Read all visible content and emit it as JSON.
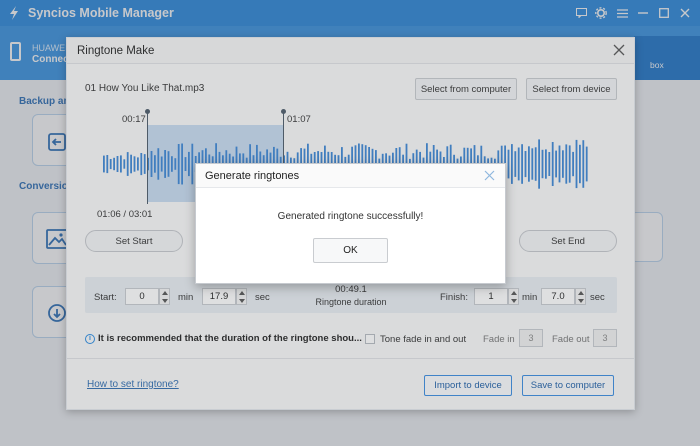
{
  "app": {
    "title": "Syncios Mobile Manager",
    "device_brand": "HUAWEI",
    "device_state": "Connect",
    "toolbox_label": "box",
    "backup_section": "Backup an",
    "conversion_section": "Conversion"
  },
  "ringtone_dialog": {
    "title": "Ringtone Make",
    "file_name": "01 How You Like That.mp3",
    "select_from_computer": "Select from computer",
    "select_from_device": "Select from device",
    "marker_start_time": "00:17",
    "marker_end_time": "01:07",
    "playback_position": "01:06 / 03:01",
    "set_start_label": "Set Start",
    "set_end_label": "Set End",
    "start_label": "Start:",
    "start_min": "0",
    "start_sec": "17.9",
    "min_unit": "min",
    "sec_unit": "sec",
    "ringtone_duration_value": "00:49.1",
    "ringtone_duration_label": "Ringtone duration",
    "finish_label": "Finish:",
    "finish_min": "1",
    "finish_sec": "7.0",
    "recommendation_text": "It is recommended that the duration of the ringtone shou...",
    "fade_checkbox_label": "Tone fade in and out",
    "fade_in_label": "Fade in",
    "fade_in_value": "3",
    "fade_out_label": "Fade out",
    "fade_out_value": "3",
    "help_link": "How to set ringtone?",
    "import_to_device": "Import to device",
    "save_to_computer": "Save to computer"
  },
  "generate_dialog": {
    "title": "Generate ringtones",
    "message": "Generated ringtone successfully!",
    "ok_label": "OK"
  },
  "colors": {
    "app_blue": "#2a8ce3",
    "header_blue": "#3897e8",
    "waveform_blue": "#3b86d6",
    "selection_blue": "#448cdc"
  }
}
